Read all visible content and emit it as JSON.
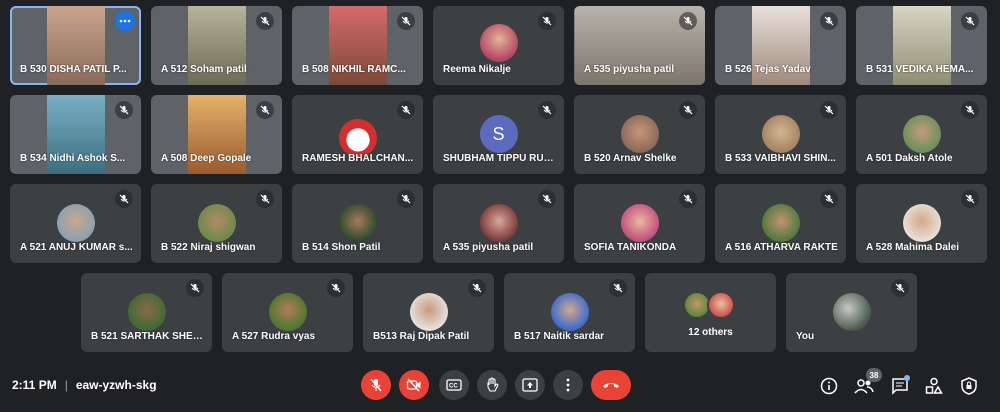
{
  "participants": [
    {
      "name": "B 530 DISHA PATIL P..."
    },
    {
      "name": "A 512 Soham patil"
    },
    {
      "name": "B 508 NIKHIL RAMC..."
    },
    {
      "name": "Reema Nikalje"
    },
    {
      "name": "A 535 piyusha patil"
    },
    {
      "name": "B 526 Tejas Yadav"
    },
    {
      "name": "B 531 VEDIKA HEMA..."
    },
    {
      "name": "B 534 Nidhi Ashok S..."
    },
    {
      "name": "A 508 Deep Gopale"
    },
    {
      "name": "RAMESH BHALCHAN..."
    },
    {
      "name": "SHUBHAM TIPPU RUKI...",
      "initial": "S"
    },
    {
      "name": "B 520 Arnav Shelke"
    },
    {
      "name": "B 533 VAIBHAVI SHIN..."
    },
    {
      "name": "A 501 Daksh Atole"
    },
    {
      "name": "A 521 ANUJ KUMAR s..."
    },
    {
      "name": "B 522 Niraj shigwan"
    },
    {
      "name": "B 514 Shon Patil"
    },
    {
      "name": "A 535 piyusha patil"
    },
    {
      "name": "SOFIA TANIKONDA"
    },
    {
      "name": "A 516 ATHARVA RAKTE"
    },
    {
      "name": "A 528 Mahima Dalei"
    },
    {
      "name": "B 521 SARTHAK SHET..."
    },
    {
      "name": "A 527 Rudra vyas"
    },
    {
      "name": "B513 Raj Dipak Patil"
    },
    {
      "name": "B 517 Naitik sardar"
    },
    {
      "name": "12 others"
    },
    {
      "name": "You"
    }
  ],
  "meeting": {
    "time": "2:11 PM",
    "separator": "|",
    "code": "eaw-yzwh-skg"
  },
  "people_count": "38",
  "colors": {
    "background": "#202124",
    "tile": "#3c4043",
    "danger": "#ea4335",
    "accent": "#1a73e8"
  },
  "icons": {
    "mic": "mic-off-icon",
    "camera": "camera-off-icon",
    "captions": "captions-icon",
    "hand": "raise-hand-icon",
    "present": "present-icon",
    "more": "more-options-icon",
    "end": "end-call-icon",
    "info": "info-icon",
    "people": "people-icon",
    "chat": "chat-icon",
    "activities": "activities-icon",
    "host": "host-controls-icon"
  }
}
